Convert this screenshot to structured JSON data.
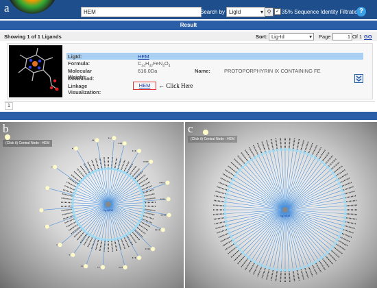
{
  "panel_labels": {
    "a": "a",
    "b": "b",
    "c": "c"
  },
  "search": {
    "value": "HEM",
    "by_label": "Search by",
    "by_value": "LigId",
    "filter_label": "35% Sequence Identity Filtration"
  },
  "result_label": "Result",
  "pager": {
    "showing": "Showing 1 of 1 Ligands",
    "sort_label": "Sort:",
    "sort_value": "Lig-Id",
    "page_label": "Page",
    "page_value": "1",
    "of_label": "Of 1",
    "go_label": "GO",
    "page_number": "1"
  },
  "ligand": {
    "ligid_label": "LigId:",
    "ligid": "HEM",
    "formula_label": "Formula:",
    "mw_label": "Molecular Weight:",
    "mw": "616.0Da",
    "name_label": "Name:",
    "name": "PROTOPORPHYRIN IX CONTAINING FE",
    "download_label": "Download:",
    "linkage_label": "Linkage Visualization:",
    "linkage_link": "HEM",
    "click_here": "← Click Here"
  },
  "network_b": {
    "central_node": "(Click it) Central Node : HEM",
    "hub": "lig:HEM"
  },
  "network_c": {
    "central_node": "(Click it) Central Node : HEM",
    "hub": "lig:HEM"
  },
  "colors": {
    "dark_blue": "#1e4f8c",
    "bar_blue": "#2a5ea7",
    "highlight_row": "#a9d0f2",
    "node_cyan": "#9fd8f0",
    "edge_blue": "#4a90d9",
    "leaf_yellow": "#fffbc8"
  }
}
